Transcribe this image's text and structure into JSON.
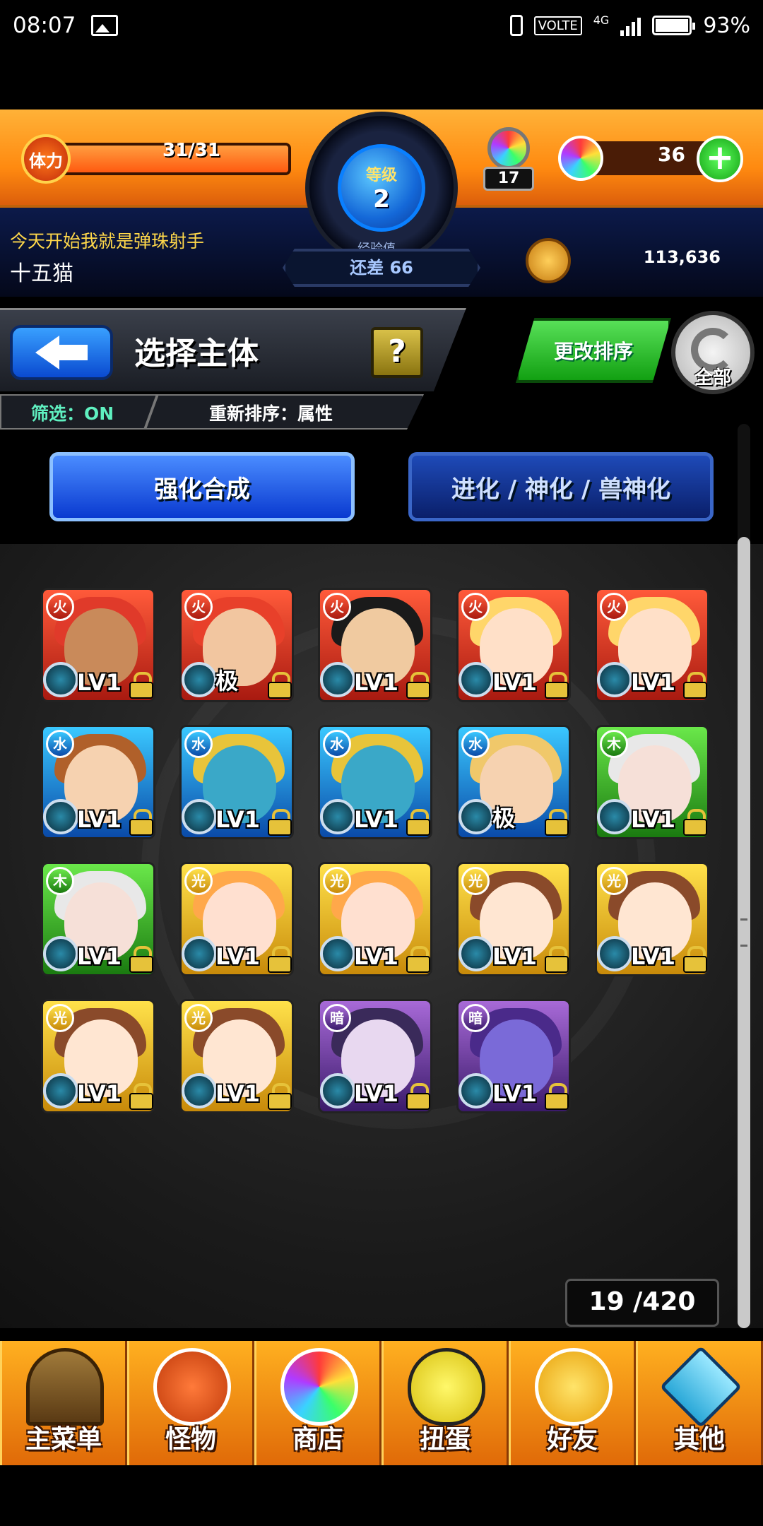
{
  "status_bar": {
    "time": "08:07",
    "volte": "VOLTE",
    "network": "4G",
    "battery": "93%"
  },
  "hud": {
    "stamina_label": "体力",
    "stamina_value": "31/31",
    "stamina_fraction": 1.0,
    "level_label": "等级",
    "level": "2",
    "exp_label": "经验值",
    "exp_remaining": "还差 66",
    "gift_orbs": "17",
    "orbs": "36",
    "plus_label": "+",
    "message": "今天开始我就是弹珠射手",
    "player_name": "十五猫",
    "coins": "113,636"
  },
  "header": {
    "title": "选择主体",
    "help_label": "?",
    "filter": "筛选：ON",
    "sort": "重新排序：属性",
    "change_sort_button": "更改排序",
    "all_button": "全部"
  },
  "tabs": [
    {
      "label": "强化合成",
      "active": true
    },
    {
      "label": "进化 / 神化 / 兽神化",
      "active": false
    }
  ],
  "monsters": [
    {
      "element": "fire",
      "level": "LV1",
      "hair": "#e03a2a",
      "skin": "#c98a5a",
      "icon": "fire-icon"
    },
    {
      "element": "fire",
      "level": "极",
      "hair": "#e8402a",
      "skin": "#f2c6a0",
      "icon": "fire-icon"
    },
    {
      "element": "fire",
      "level": "LV1",
      "hair": "#1a1a1a",
      "skin": "#f0caa0",
      "icon": "fire-icon"
    },
    {
      "element": "fire",
      "level": "LV1",
      "hair": "#ffd66a",
      "skin": "#ffe0c8",
      "icon": "fire-icon"
    },
    {
      "element": "fire",
      "level": "LV1",
      "hair": "#ffd66a",
      "skin": "#ffe0c8",
      "icon": "fire-icon"
    },
    {
      "element": "water",
      "level": "LV1",
      "hair": "#b0602a",
      "skin": "#f6d2b0",
      "icon": "water-icon"
    },
    {
      "element": "water",
      "level": "LV1",
      "hair": "#e8c43a",
      "skin": "#3aa8c8",
      "icon": "water-icon"
    },
    {
      "element": "water",
      "level": "LV1",
      "hair": "#e8c43a",
      "skin": "#3aa8c8",
      "icon": "water-icon"
    },
    {
      "element": "water",
      "level": "极",
      "hair": "#f0c86a",
      "skin": "#f6d2b0",
      "icon": "water-icon"
    },
    {
      "element": "wood",
      "level": "LV1",
      "hair": "#e8e8e8",
      "skin": "#f6e0d8",
      "icon": "wood-icon"
    },
    {
      "element": "wood",
      "level": "LV1",
      "hair": "#e8e8e8",
      "skin": "#f6e0d8",
      "icon": "wood-icon"
    },
    {
      "element": "light",
      "level": "LV1",
      "hair": "#ffa84a",
      "skin": "#ffe0d0",
      "icon": "light-icon"
    },
    {
      "element": "light",
      "level": "LV1",
      "hair": "#ffa84a",
      "skin": "#ffe0d0",
      "icon": "light-icon"
    },
    {
      "element": "light",
      "level": "LV1",
      "hair": "#8a4a2a",
      "skin": "#ffe6d2",
      "icon": "light-icon"
    },
    {
      "element": "light",
      "level": "LV1",
      "hair": "#8a4a2a",
      "skin": "#ffe6d2",
      "icon": "light-icon"
    },
    {
      "element": "light",
      "level": "LV1",
      "hair": "#8a4a2a",
      "skin": "#ffe6d2",
      "icon": "light-icon"
    },
    {
      "element": "light",
      "level": "LV1",
      "hair": "#8a4a2a",
      "skin": "#ffe6d2",
      "icon": "light-icon"
    },
    {
      "element": "dark",
      "level": "LV1",
      "hair": "#3a2a5a",
      "skin": "#e8d8f0",
      "icon": "dark-icon"
    },
    {
      "element": "dark",
      "level": "LV1",
      "hair": "#4a2a8a",
      "skin": "#7a6ad8",
      "icon": "dark-icon"
    }
  ],
  "box_count": "19 /420",
  "nav": [
    {
      "label": "主菜单",
      "icon": "gate-icon",
      "cls": "ic-gate"
    },
    {
      "label": "怪物",
      "icon": "monster-icon",
      "cls": "ic-monster"
    },
    {
      "label": "商店",
      "icon": "orb-icon",
      "cls": "ic-orb"
    },
    {
      "label": "扭蛋",
      "icon": "egg-icon",
      "cls": "ic-egg"
    },
    {
      "label": "好友",
      "icon": "friend-icon",
      "cls": "ic-friend"
    },
    {
      "label": "其他",
      "icon": "other-icon",
      "cls": "ic-other"
    }
  ]
}
